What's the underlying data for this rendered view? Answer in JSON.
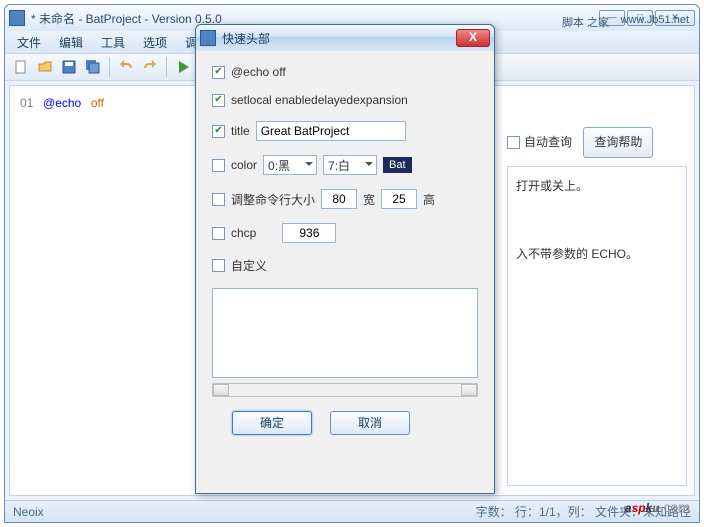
{
  "main_window": {
    "title": "* 未命名 - BatProject - Version 0.5.0",
    "top_right_label": "脚本 之家",
    "top_right_url": "www.Jb51.net"
  },
  "menu": [
    "文件",
    "编辑",
    "工具",
    "选项",
    "调试"
  ],
  "editor": {
    "line_number": "01",
    "at": "@",
    "keyword": "echo",
    "arg": "off"
  },
  "right_panel": {
    "auto_query": "自动查询",
    "help_btn": "查询帮助",
    "line1": "打开或关上。",
    "line2": "入不带参数的 ECHO。"
  },
  "statusbar": {
    "left": "Neoix",
    "right": "字数：          行：1/1，列：   文件夹：未知路径"
  },
  "watermark": {
    "text": "aspku",
    "suffix": ".com"
  },
  "dialog": {
    "title": "快速头部",
    "echo": {
      "checked": true,
      "label": "@echo off"
    },
    "setlocal": {
      "checked": true,
      "label": "setlocal enabledelayedexpansion"
    },
    "title_row": {
      "checked": true,
      "label": "title",
      "value": "Great BatProject"
    },
    "color": {
      "checked": false,
      "label": "color",
      "fg": "0:黑",
      "bg": "7:白",
      "badge": "Bat"
    },
    "size": {
      "checked": false,
      "label": "调整命令行大小",
      "width": "80",
      "wlabel": "宽",
      "height": "25",
      "hlabel": "高"
    },
    "chcp": {
      "checked": false,
      "label": "chcp",
      "value": "936"
    },
    "custom": {
      "checked": false,
      "label": "自定义"
    },
    "ok": "确定",
    "cancel": "取消"
  }
}
